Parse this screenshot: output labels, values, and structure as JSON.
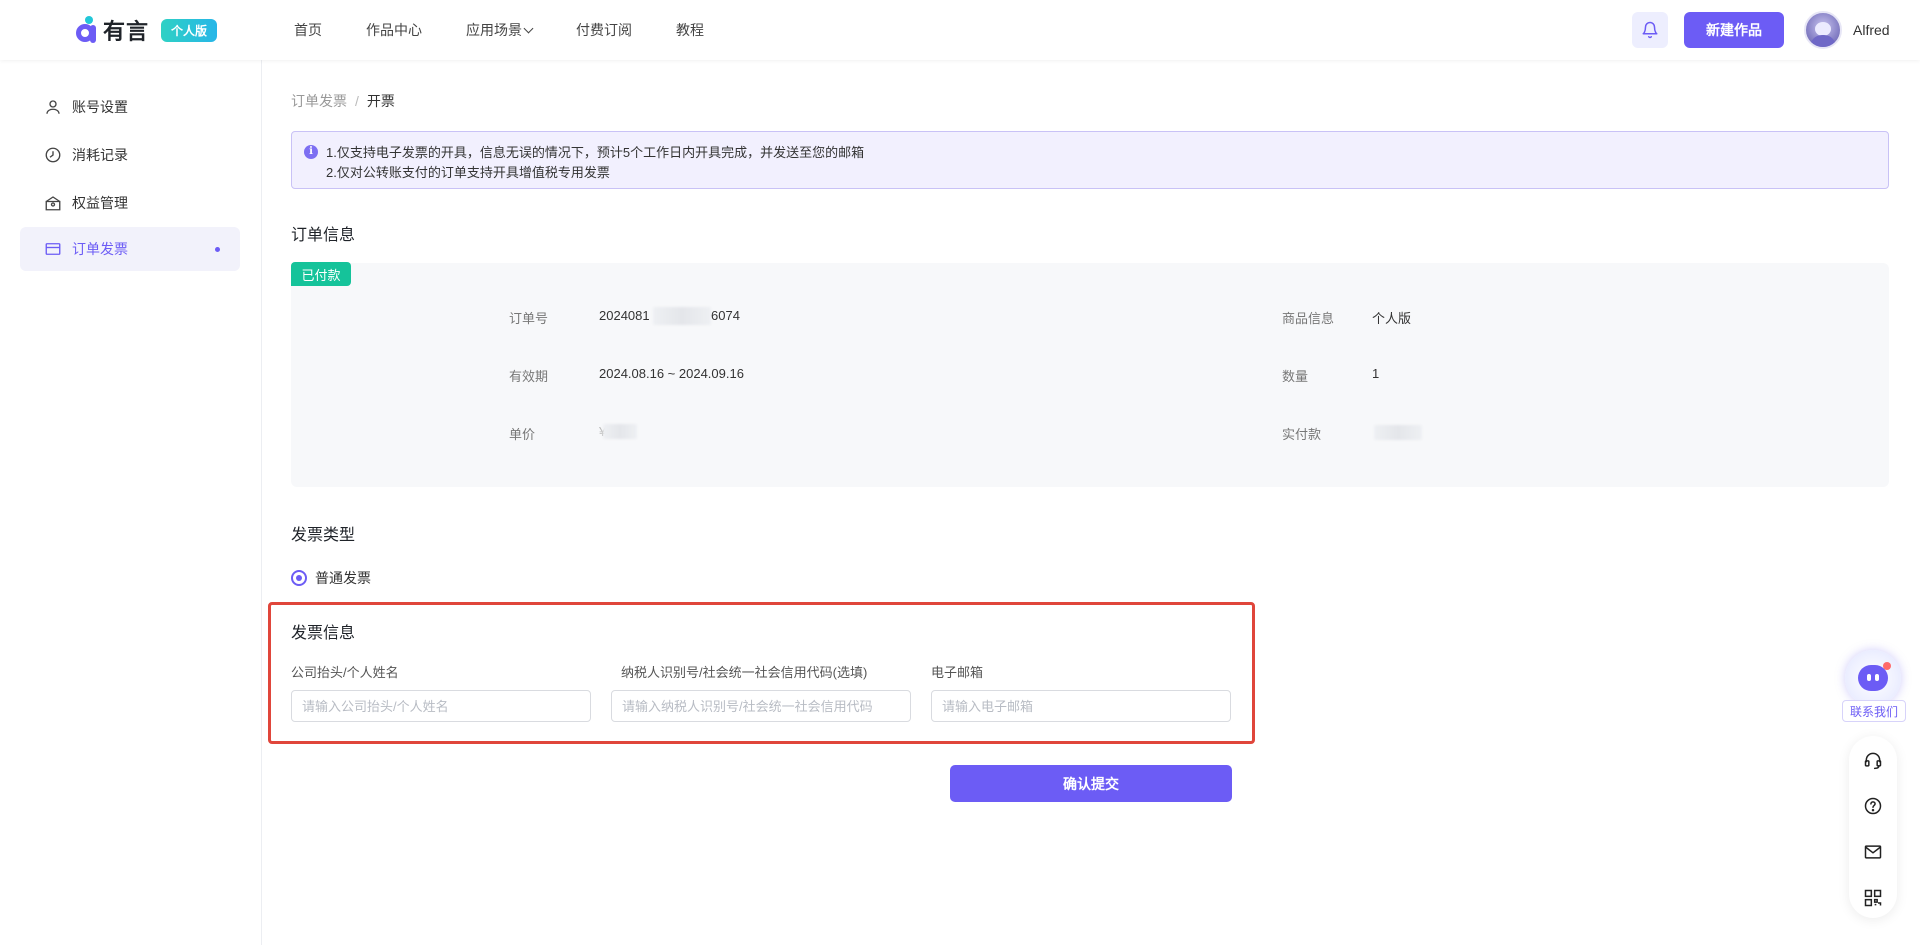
{
  "header": {
    "logo_text": "有言",
    "logo_badge": "个人版",
    "nav": [
      "首页",
      "作品中心",
      "应用场景",
      "付费订阅",
      "教程"
    ],
    "new_button": "新建作品",
    "username": "Alfred"
  },
  "sidebar": {
    "items": [
      {
        "label": "账号设置",
        "icon": "user-icon"
      },
      {
        "label": "消耗记录",
        "icon": "clock-icon"
      },
      {
        "label": "权益管理",
        "icon": "gift-box-icon"
      },
      {
        "label": "订单发票",
        "icon": "card-icon",
        "active": true
      }
    ]
  },
  "breadcrumb": {
    "parent": "订单发票",
    "separator": "/",
    "current": "开票"
  },
  "notice": {
    "line1": "1.仅支持电子发票的开具，信息无误的情况下，预计5个工作日内开具完成，并发送至您的邮箱",
    "line2": "2.仅对公转账支付的订单支持开具增值税专用发票"
  },
  "order": {
    "title": "订单信息",
    "status_badge": "已付款",
    "fields": {
      "order_no_label": "订单号",
      "order_no_prefix": "2024081",
      "order_no_suffix": "6074",
      "validity_label": "有效期",
      "validity_value": "2024.08.16 ~ 2024.09.16",
      "unit_price_label": "单价",
      "unit_price_value": "¥",
      "product_label": "商品信息",
      "product_value": "个人版",
      "quantity_label": "数量",
      "quantity_value": "1",
      "paid_label": "实付款"
    }
  },
  "invoice_type": {
    "title": "发票类型",
    "option": "普通发票"
  },
  "invoice_info": {
    "title": "发票信息",
    "company_label": "公司抬头/个人姓名",
    "company_placeholder": "请输入公司抬头/个人姓名",
    "tax_label": "纳税人识别号/社会统一社会信用代码(选填)",
    "tax_placeholder": "请输入纳税人识别号/社会统一社会信用代码",
    "email_label": "电子邮箱",
    "email_placeholder": "请输入电子邮箱"
  },
  "submit_label": "确认提交",
  "helper": {
    "contact_label": "联系我们"
  },
  "colors": {
    "accent": "#6c5cf5",
    "paid": "#15c39a",
    "highlight": "#e0463b"
  }
}
